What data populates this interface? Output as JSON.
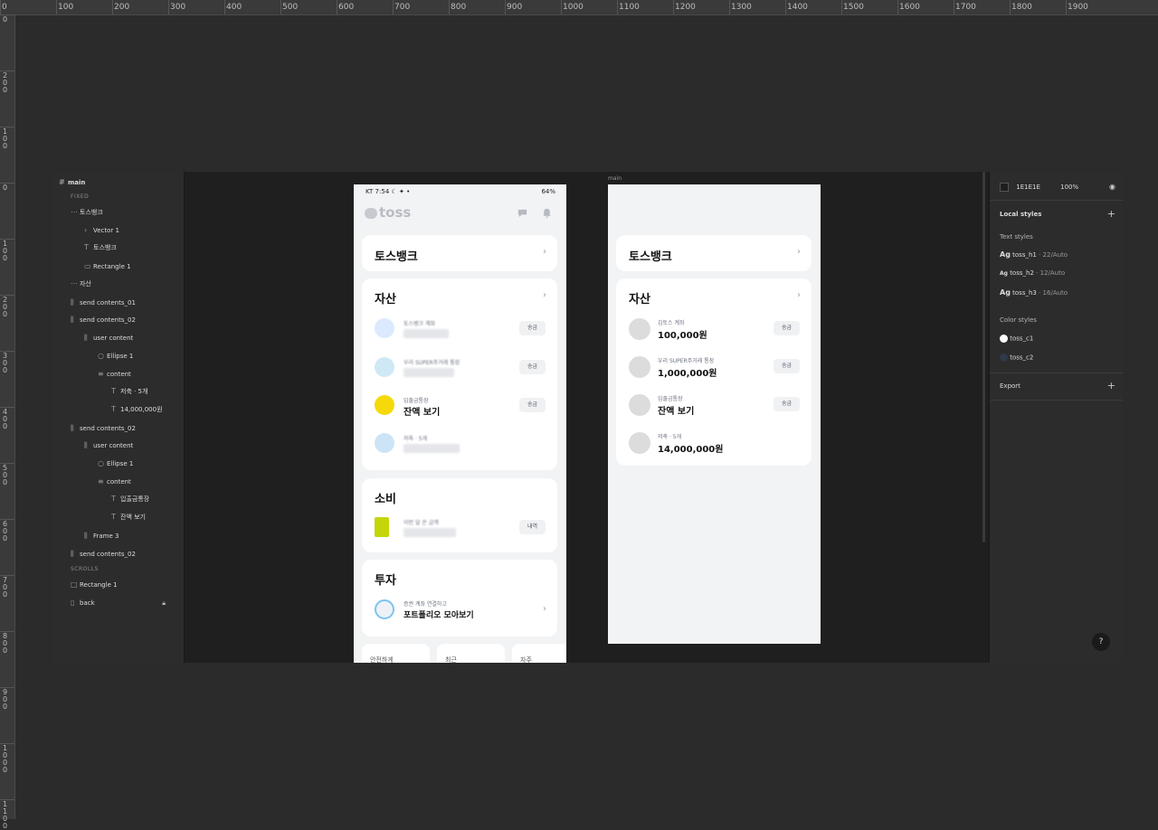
{
  "ruler": {
    "top": [
      "0",
      "100",
      "200",
      "300",
      "400",
      "500",
      "600",
      "700",
      "800",
      "900",
      "1000",
      "1100",
      "1200",
      "1300",
      "1400",
      "1500",
      "1600",
      "1700",
      "1800",
      "1900"
    ],
    "left": [
      "0",
      "200",
      "100",
      "0",
      "100",
      "200",
      "300",
      "400",
      "500",
      "600",
      "700",
      "800",
      "900",
      "1000",
      "1100"
    ]
  },
  "layers": {
    "root": "main",
    "fixed_section": "FIXED",
    "scrolls_section": "SCROLLS",
    "items": [
      {
        "label": "토스뱅크"
      },
      {
        "label": "Vector 1"
      },
      {
        "label": "토스뱅크"
      },
      {
        "label": "Rectangle 1"
      },
      {
        "label": "자산"
      },
      {
        "label": "send contents_01"
      },
      {
        "label": "send contents_02"
      },
      {
        "label": "user content"
      },
      {
        "label": "Ellipse 1"
      },
      {
        "label": "content"
      },
      {
        "label": "저축 · 5개"
      },
      {
        "label": "14,000,000원"
      },
      {
        "label": "send contents_02"
      },
      {
        "label": "user content"
      },
      {
        "label": "Ellipse 1"
      },
      {
        "label": "content"
      },
      {
        "label": "입출금통장"
      },
      {
        "label": "잔액 보기"
      },
      {
        "label": "Frame 3"
      },
      {
        "label": "send contents_02"
      },
      {
        "label": "Rectangle 1"
      },
      {
        "label": "back"
      }
    ]
  },
  "phone1": {
    "status_left": "KT 7:54 ☾ ✦ •",
    "status_right": "64%",
    "logo": "toss",
    "bank_title": "토스뱅크",
    "assets_title": "자산",
    "assets_rows": [
      {
        "label": "토스뱅크 계좌",
        "pill": "송금"
      },
      {
        "label": "우리 SUPER주거래 통장",
        "pill": "송금"
      },
      {
        "label": "입출금통장",
        "value": "잔액 보기",
        "pill": "송금"
      },
      {
        "label": "저축 · 5개"
      }
    ],
    "spend_title": "소비",
    "spend_label": "이번 달 쓴 금액",
    "spend_pill": "내역",
    "invest_title": "투자",
    "invest_label": "증권 계좌 연결하고",
    "invest_value": "포트폴리오 모아보기",
    "bottom_tabs": [
      "안전하게",
      "최근",
      "자주"
    ]
  },
  "phone2": {
    "frame_label": "main",
    "bank_title": "토스뱅크",
    "assets_title": "자산",
    "rows": [
      {
        "label": "김토스 계좌",
        "value": "100,000원",
        "pill": "송금"
      },
      {
        "label": "우리 SUPER주거래 통장",
        "value": "1,000,000원",
        "pill": "송금"
      },
      {
        "label": "입출금통장",
        "value": "잔액 보기",
        "pill": "송금"
      },
      {
        "label": "저축 · 5개",
        "value": "14,000,000원"
      }
    ]
  },
  "props": {
    "fill_hex": "1E1E1E",
    "fill_opacity": "100%",
    "local_styles": "Local styles",
    "text_styles": "Text styles",
    "text_style_items": [
      {
        "ag": "Ag",
        "name": "toss_h1",
        "meta": " · 22/Auto"
      },
      {
        "ag": "Ag",
        "name": "toss_h2",
        "meta": " · 12/Auto"
      },
      {
        "ag": "Ag",
        "name": "toss_h3",
        "meta": " · 16/Auto"
      }
    ],
    "color_styles": "Color styles",
    "color_style_items": [
      {
        "name": "toss_c1",
        "color": "#ffffff"
      },
      {
        "name": "toss_c2",
        "color": "#2f3a4a"
      }
    ],
    "export": "Export",
    "help": "?"
  },
  "colors": {
    "canvas": "#2b2b2b",
    "screen_bg": "#f2f3f5",
    "card": "#ffffff",
    "yellow": "#f5d90a",
    "blue": "#3b82f6"
  }
}
